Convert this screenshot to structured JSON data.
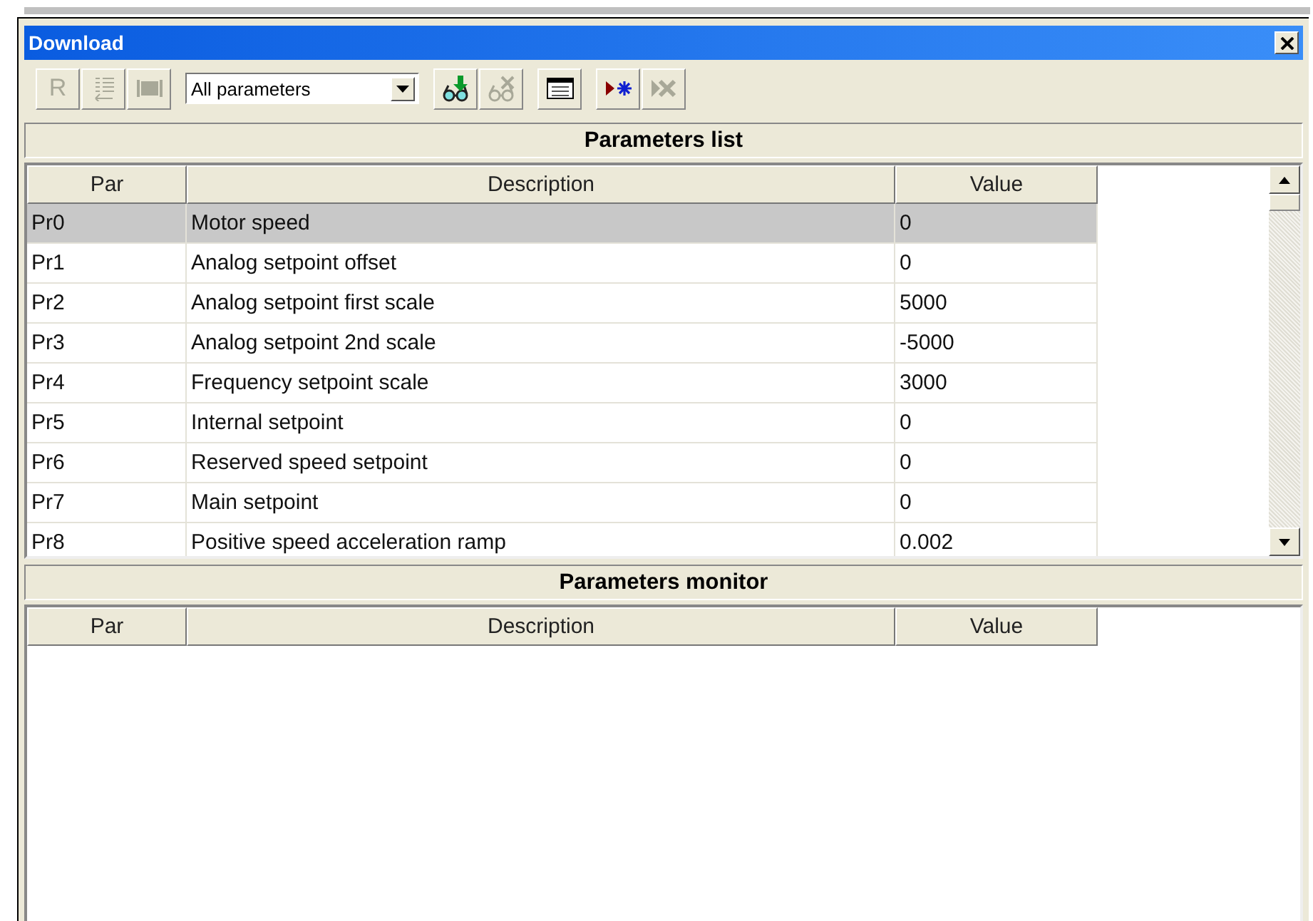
{
  "window": {
    "title": "Download"
  },
  "toolbar": {
    "buttons_left": [
      {
        "kind": "letter",
        "label": "R",
        "disabled": true
      },
      {
        "kind": "list",
        "disabled": true
      },
      {
        "kind": "chip",
        "disabled": true
      }
    ],
    "filter": {
      "value": "All parameters"
    },
    "button_groups": [
      [
        {
          "kind": "read",
          "disabled": false
        },
        {
          "kind": "read-cancel",
          "disabled": true
        }
      ],
      [
        {
          "kind": "table",
          "disabled": false
        }
      ],
      [
        {
          "kind": "start",
          "disabled": false
        },
        {
          "kind": "stop",
          "disabled": true
        }
      ]
    ]
  },
  "parameters_list": {
    "title": "Parameters list",
    "columns": [
      "Par",
      "Description",
      "Value"
    ],
    "rows": [
      {
        "par": "Pr0",
        "description": "Motor speed",
        "value": "0",
        "selected": true
      },
      {
        "par": "Pr1",
        "description": "Analog setpoint offset",
        "value": "0",
        "selected": false
      },
      {
        "par": "Pr2",
        "description": "Analog setpoint first scale",
        "value": "5000",
        "selected": false
      },
      {
        "par": "Pr3",
        "description": "Analog setpoint 2nd scale",
        "value": "-5000",
        "selected": false
      },
      {
        "par": "Pr4",
        "description": "Frequency setpoint scale",
        "value": "3000",
        "selected": false
      },
      {
        "par": "Pr5",
        "description": "Internal setpoint",
        "value": "0",
        "selected": false
      },
      {
        "par": "Pr6",
        "description": "Reserved speed setpoint",
        "value": "0",
        "selected": false
      },
      {
        "par": "Pr7",
        "description": "Main setpoint",
        "value": "0",
        "selected": false
      },
      {
        "par": "Pr8",
        "description": "Positive speed acceleration ramp",
        "value": "0.002",
        "selected": false
      }
    ]
  },
  "parameters_monitor": {
    "title": "Parameters monitor",
    "columns": [
      "Par",
      "Description",
      "Value"
    ]
  }
}
